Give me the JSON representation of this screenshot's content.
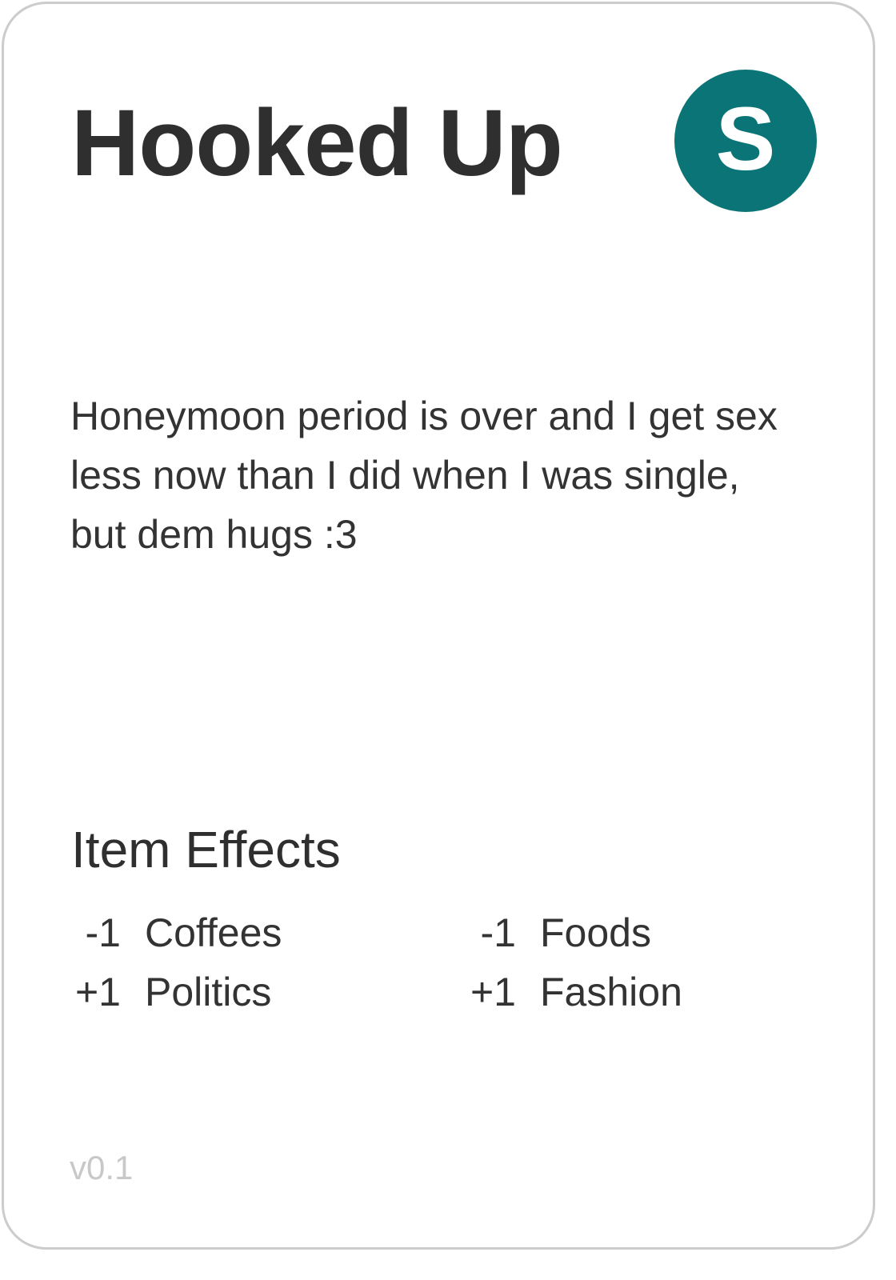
{
  "card": {
    "title": "Hooked Up",
    "badge": {
      "letter": "S",
      "color": "#0b7477"
    },
    "description": "Honeymoon period is over and I get sex less now than I did when I was single, but dem hugs :3",
    "effects_heading": "Item Effects",
    "effects": [
      {
        "value": "-1",
        "label": "Coffees"
      },
      {
        "value": "-1",
        "label": "Foods"
      },
      {
        "value": "+1",
        "label": "Politics"
      },
      {
        "value": "+1",
        "label": "Fashion"
      }
    ],
    "version": "v0.1"
  }
}
